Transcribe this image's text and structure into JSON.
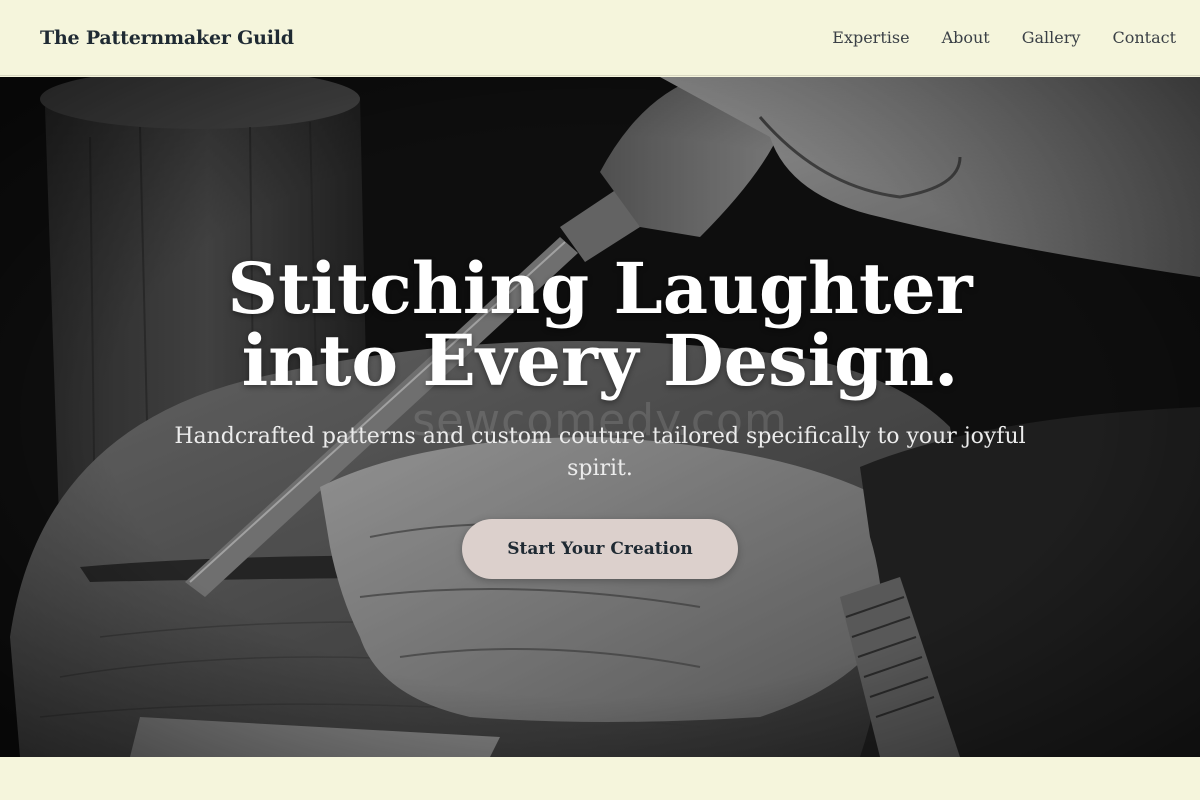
{
  "header": {
    "brand": "The Patternmaker Guild",
    "nav": [
      {
        "label": "Expertise"
      },
      {
        "label": "About"
      },
      {
        "label": "Gallery"
      },
      {
        "label": "Contact"
      }
    ]
  },
  "hero": {
    "headline": "Stitching Laughter into Every Design.",
    "subheadline": "Handcrafted patterns and custom couture tailored specifically to your joyful spirit.",
    "cta_label": "Start Your Creation",
    "watermark": "sewcomedy.com",
    "image_description_icon": "woodcarving-hands-photo"
  },
  "colors": {
    "page_background": "#f5f5dc",
    "text_dark": "#1f2a33",
    "cta_background": "#dcd0cc"
  }
}
